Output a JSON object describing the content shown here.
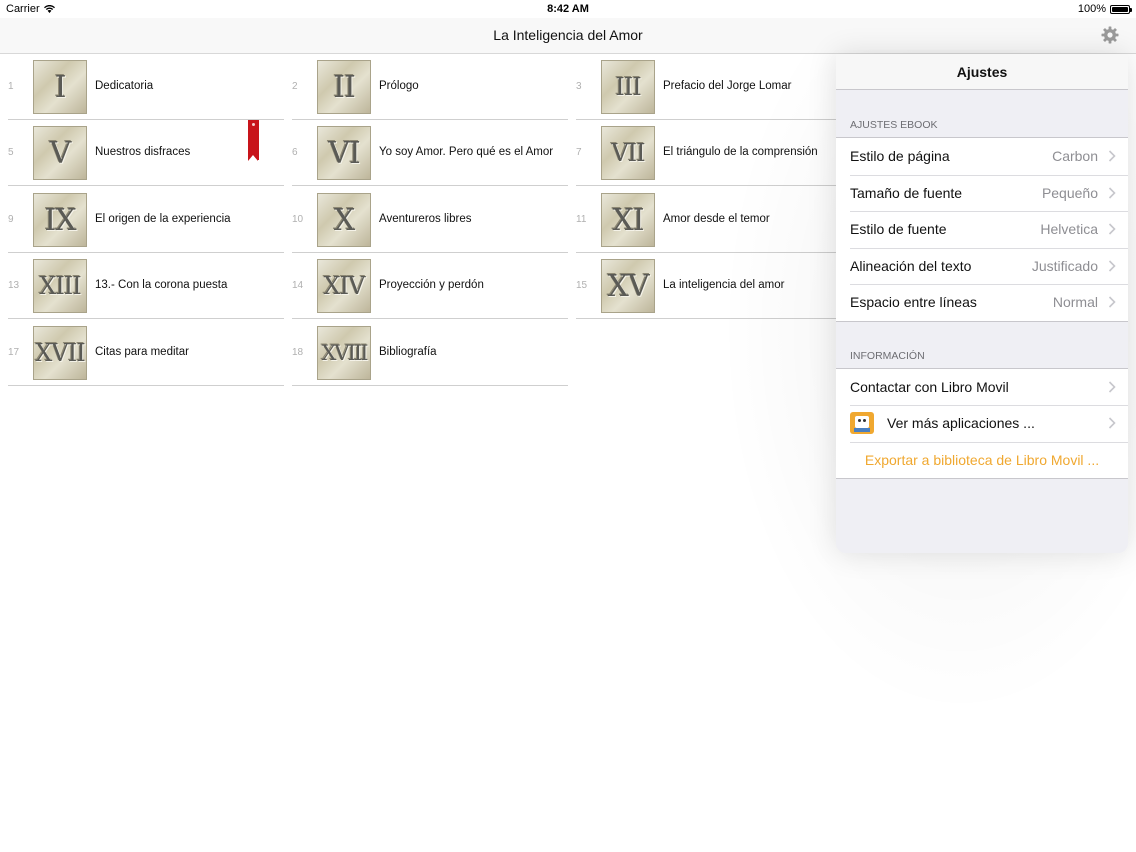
{
  "status_bar": {
    "carrier": "Carrier",
    "time": "8:42 AM",
    "battery": "100%"
  },
  "nav": {
    "title": "La Inteligencia del Amor",
    "settings_icon": "gear-icon"
  },
  "chapters": [
    {
      "number": "1",
      "numeral": "I",
      "title": "Dedicatoria"
    },
    {
      "number": "2",
      "numeral": "II",
      "title": "Prólogo"
    },
    {
      "number": "3",
      "numeral": "III",
      "title": "Prefacio del Jorge Lomar"
    },
    {
      "number": "5",
      "numeral": "V",
      "title": "Nuestros disfraces",
      "bookmarked": true
    },
    {
      "number": "6",
      "numeral": "VI",
      "title": "Yo soy Amor. Pero qué es el Amor"
    },
    {
      "number": "7",
      "numeral": "VII",
      "title": "El triángulo de la comprensión"
    },
    {
      "number": "9",
      "numeral": "IX",
      "title": "El origen de la experiencia"
    },
    {
      "number": "10",
      "numeral": "X",
      "title": "Aventureros libres"
    },
    {
      "number": "11",
      "numeral": "XI",
      "title": "Amor desde el temor"
    },
    {
      "number": "13",
      "numeral": "XIII",
      "title": "13.- Con la corona puesta"
    },
    {
      "number": "14",
      "numeral": "XIV",
      "title": "Proyección y perdón"
    },
    {
      "number": "15",
      "numeral": "XV",
      "title": "La inteligencia del amor"
    },
    {
      "number": "17",
      "numeral": "XVII",
      "title": "Citas para meditar"
    },
    {
      "number": "18",
      "numeral": "XVIII",
      "title": "Bibliografía"
    }
  ],
  "popover": {
    "title": "Ajustes",
    "ebook_section": "AJUSTES EBOOK",
    "ebook_rows": [
      {
        "label": "Estilo de página",
        "value": "Carbon"
      },
      {
        "label": "Tamaño de fuente",
        "value": "Pequeño"
      },
      {
        "label": "Estilo de fuente",
        "value": "Helvetica"
      },
      {
        "label": "Alineación del texto",
        "value": "Justificado"
      },
      {
        "label": "Espacio entre líneas",
        "value": "Normal"
      }
    ],
    "info_section": "INFORMACIÓN",
    "info_rows": {
      "contact": "Contactar con Libro Movil",
      "more_apps": "Ver más aplicaciones ...",
      "export": "Exportar a biblioteca de Libro Movil ..."
    },
    "accent_color": "#f0a830"
  }
}
